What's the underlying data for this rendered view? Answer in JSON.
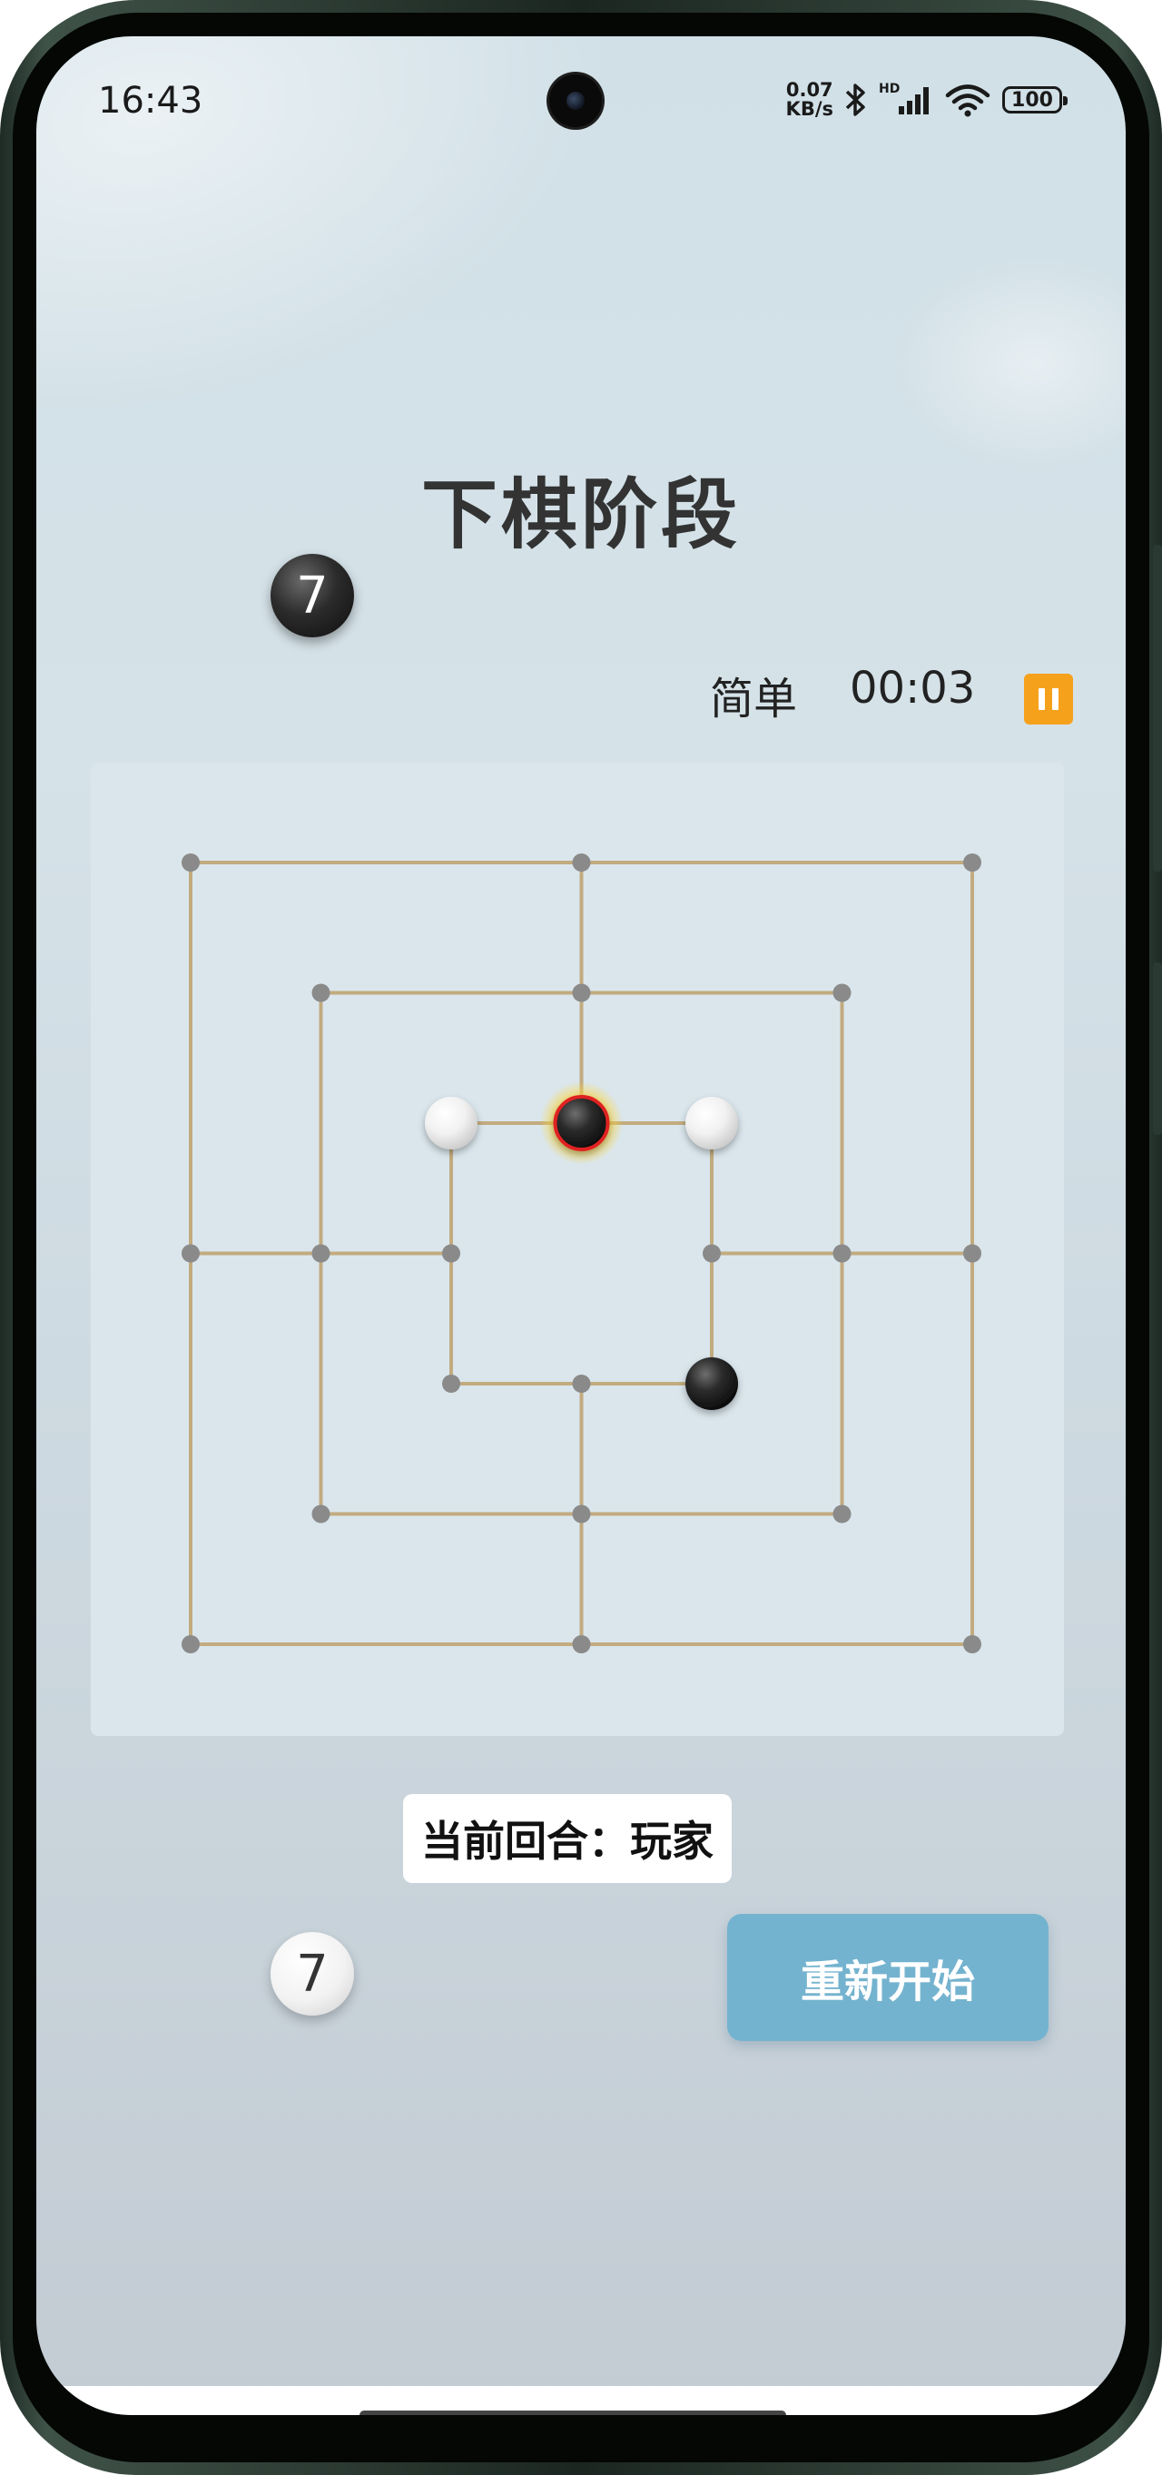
{
  "status_bar": {
    "time": "16:43",
    "net_speed_value": "0.07",
    "net_speed_unit": "KB/s",
    "network_type": "HD",
    "battery": "100"
  },
  "game": {
    "title": "下棋阶段",
    "difficulty": "简单",
    "timer": "00:03",
    "black_remaining": "7",
    "white_remaining": "7",
    "turn_label": "当前回合：玩家",
    "restart_label": "重新开始"
  },
  "board": {
    "line_color": "#c2ab7f",
    "point_color": "#8a8a8a",
    "highlight_color": "#e02020",
    "points": [
      {
        "label": "a7",
        "col": 0,
        "row": 0
      },
      {
        "label": "d7",
        "col": 3,
        "row": 0
      },
      {
        "label": "g7",
        "col": 6,
        "row": 0
      },
      {
        "label": "b6",
        "col": 1,
        "row": 1
      },
      {
        "label": "d6",
        "col": 3,
        "row": 1
      },
      {
        "label": "f6",
        "col": 5,
        "row": 1
      },
      {
        "label": "c5",
        "col": 2,
        "row": 2
      },
      {
        "label": "d5",
        "col": 3,
        "row": 2
      },
      {
        "label": "e5",
        "col": 4,
        "row": 2
      },
      {
        "label": "a4",
        "col": 0,
        "row": 3
      },
      {
        "label": "b4",
        "col": 1,
        "row": 3
      },
      {
        "label": "c4",
        "col": 2,
        "row": 3
      },
      {
        "label": "e4",
        "col": 4,
        "row": 3
      },
      {
        "label": "f4",
        "col": 5,
        "row": 3
      },
      {
        "label": "g4",
        "col": 6,
        "row": 3
      },
      {
        "label": "c3",
        "col": 2,
        "row": 4
      },
      {
        "label": "d3",
        "col": 3,
        "row": 4
      },
      {
        "label": "e3",
        "col": 4,
        "row": 4
      },
      {
        "label": "b2",
        "col": 1,
        "row": 5
      },
      {
        "label": "d2",
        "col": 3,
        "row": 5
      },
      {
        "label": "f2",
        "col": 5,
        "row": 5
      },
      {
        "label": "a1",
        "col": 0,
        "row": 6
      },
      {
        "label": "d1",
        "col": 3,
        "row": 6
      },
      {
        "label": "g1",
        "col": 6,
        "row": 6
      }
    ],
    "pieces": [
      {
        "point": "c5",
        "color": "white",
        "highlighted": false
      },
      {
        "point": "d5",
        "color": "black",
        "highlighted": true
      },
      {
        "point": "e5",
        "color": "white",
        "highlighted": false
      },
      {
        "point": "e3",
        "color": "black",
        "highlighted": false
      }
    ]
  }
}
